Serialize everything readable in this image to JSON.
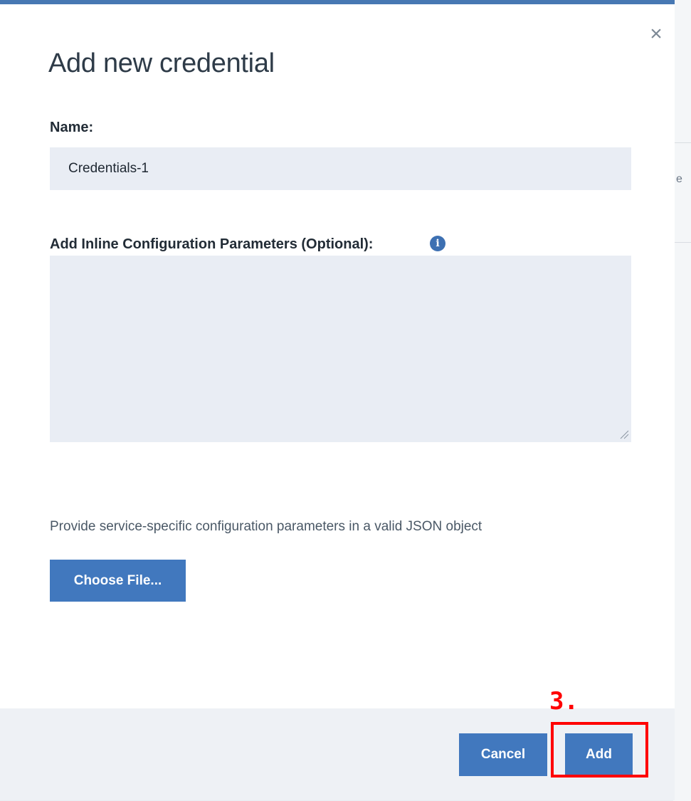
{
  "dialog": {
    "title": "Add new credential",
    "close_label": "×"
  },
  "name_field": {
    "label": "Name:",
    "value": "Credentials-1"
  },
  "params_field": {
    "label": "Add Inline Configuration Parameters (Optional):",
    "info_glyph": "i",
    "value": ""
  },
  "help_text": "Provide service-specific configuration parameters in a valid JSON object",
  "choose_file_label": "Choose File...",
  "footer": {
    "cancel_label": "Cancel",
    "add_label": "Add"
  },
  "annotation": {
    "step_label": "3.",
    "color": "#ff0000"
  },
  "background": {
    "fragment_text": "e"
  },
  "colors": {
    "accent": "#4178be",
    "header_bar": "#4778b3",
    "input_bg": "#e9edf4"
  }
}
